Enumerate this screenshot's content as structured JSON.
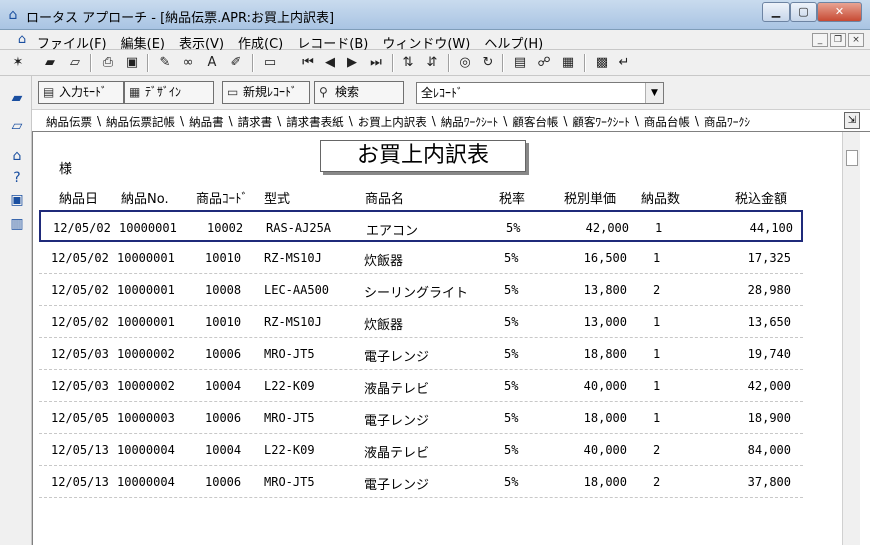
{
  "window": {
    "title": "ロータス アプローチ - [納品伝票.APR:お買上内訳表]"
  },
  "menu": [
    "ファイル(F)",
    "編集(E)",
    "表示(V)",
    "作成(C)",
    "レコード(B)",
    "ウィンドウ(W)",
    "ヘルプ(H)"
  ],
  "modebar": {
    "input_mode": "入力ﾓｰﾄﾞ",
    "design": "ﾃﾞｻﾞｲﾝ",
    "new_record": "新規ﾚｺｰﾄﾞ",
    "search": "検索",
    "record_filter": "全ﾚｺｰﾄﾞ"
  },
  "tabs": [
    "納品伝票",
    "納品伝票記帳",
    "納品書",
    "請求書",
    "請求書表紙",
    "お買上内訳表",
    "納品ﾜｰｸｼｰﾄ",
    "顧客台帳",
    "顧客ﾜｰｸｼｰﾄ",
    "商品台帳",
    "商品ﾜｰｸｼ"
  ],
  "active_tab_index": 5,
  "report": {
    "title": "お買上内訳表",
    "customer_suffix": "様",
    "columns": [
      "納品日",
      "納品No.",
      "商品ｺｰﾄﾞ",
      "型式",
      "商品名",
      "税率",
      "税別単価",
      "納品数",
      "税込金額"
    ],
    "rows": [
      [
        "12/05/02",
        "10000001",
        "10002",
        "RAS-AJ25A",
        "エアコン",
        "5%",
        "42,000",
        "1",
        "44,100"
      ],
      [
        "12/05/02",
        "10000001",
        "10010",
        "RZ-MS10J",
        "炊飯器",
        "5%",
        "16,500",
        "1",
        "17,325"
      ],
      [
        "12/05/02",
        "10000001",
        "10008",
        "LEC-AA500",
        "シーリングライト",
        "5%",
        "13,800",
        "2",
        "28,980"
      ],
      [
        "12/05/02",
        "10000001",
        "10010",
        "RZ-MS10J",
        "炊飯器",
        "5%",
        "13,000",
        "1",
        "13,650"
      ],
      [
        "12/05/03",
        "10000002",
        "10006",
        "MRO-JT5",
        "電子レンジ",
        "5%",
        "18,800",
        "1",
        "19,740"
      ],
      [
        "12/05/03",
        "10000002",
        "10004",
        "L22-K09",
        "液晶テレビ",
        "5%",
        "40,000",
        "1",
        "42,000"
      ],
      [
        "12/05/05",
        "10000003",
        "10006",
        "MRO-JT5",
        "電子レンジ",
        "5%",
        "18,000",
        "1",
        "18,900"
      ],
      [
        "12/05/13",
        "10000004",
        "10004",
        "L22-K09",
        "液晶テレビ",
        "5%",
        "40,000",
        "2",
        "84,000"
      ],
      [
        "12/05/13",
        "10000004",
        "10006",
        "MRO-JT5",
        "電子レンジ",
        "5%",
        "18,000",
        "2",
        "37,800"
      ]
    ]
  }
}
